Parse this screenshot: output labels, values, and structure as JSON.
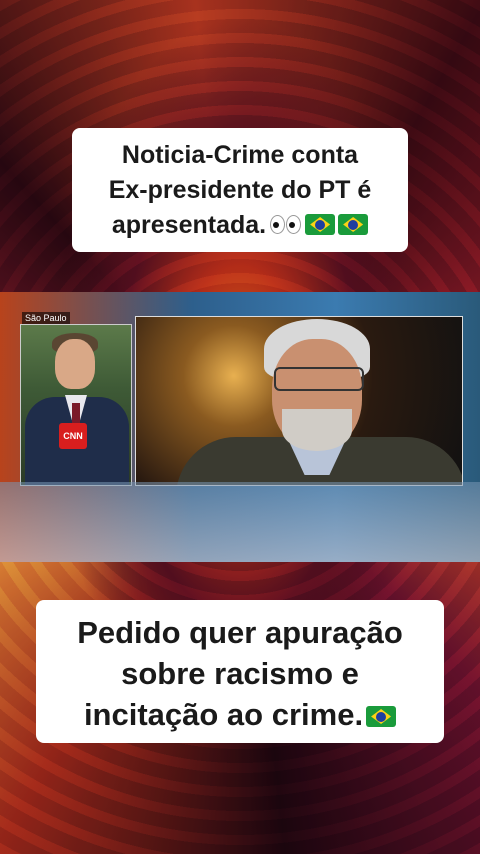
{
  "captions": {
    "top": {
      "line1": "Noticia-Crime conta",
      "line2": "Ex-presidente do PT é",
      "line3": "apresentada."
    },
    "bottom": {
      "line1": "Pedido quer apuração",
      "line2": "sobre racismo e",
      "line3": "incitação ao crime."
    }
  },
  "news_frame": {
    "location": "São Paulo",
    "mic_logo": "CNN"
  },
  "icons": [
    "eyes-emoji",
    "brazil-flag-emoji"
  ],
  "colors": {
    "caption_bg": "#ffffff",
    "caption_text": "#1a1a1a",
    "flag_green": "#1a9b3b",
    "flag_yellow": "#fcd116",
    "flag_blue": "#1e3fa0"
  }
}
